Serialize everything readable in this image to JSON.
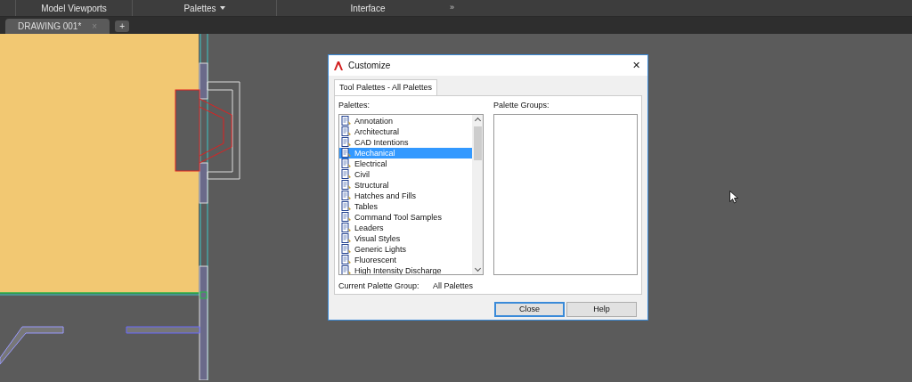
{
  "ribbon": {
    "panels": [
      {
        "label": "Model Viewports",
        "has_menu": false
      },
      {
        "label": "Palettes",
        "has_menu": true
      },
      {
        "label": "Interface",
        "has_menu": false
      }
    ],
    "overflow": "»"
  },
  "file_tabs": [
    {
      "label": "DRAWING 001*",
      "close": "×",
      "selected": true
    }
  ],
  "new_tab": "+",
  "dialog": {
    "title": "Customize",
    "close": "✕",
    "tabs": [
      {
        "label": "Tool Palettes - All Palettes",
        "selected": true
      }
    ],
    "palettes_label": "Palettes:",
    "palettes": [
      {
        "label": "Annotation",
        "selected": false
      },
      {
        "label": "Architectural",
        "selected": false
      },
      {
        "label": "CAD Intentions",
        "selected": false
      },
      {
        "label": "Mechanical",
        "selected": true
      },
      {
        "label": "Electrical",
        "selected": false
      },
      {
        "label": "Civil",
        "selected": false
      },
      {
        "label": "Structural",
        "selected": false
      },
      {
        "label": "Hatches and Fills",
        "selected": false
      },
      {
        "label": "Tables",
        "selected": false
      },
      {
        "label": "Command Tool Samples",
        "selected": false
      },
      {
        "label": "Leaders",
        "selected": false
      },
      {
        "label": "Visual Styles",
        "selected": false
      },
      {
        "label": "Generic Lights",
        "selected": false
      },
      {
        "label": "Fluorescent",
        "selected": false
      },
      {
        "label": "High Intensity Discharge",
        "selected": false
      }
    ],
    "groups_label": "Palette Groups:",
    "current_group_label": "Current Palette Group:",
    "current_group_value": "All Palettes",
    "buttons": [
      {
        "label": "Close",
        "default": true
      },
      {
        "label": "Help",
        "default": false
      }
    ]
  }
}
